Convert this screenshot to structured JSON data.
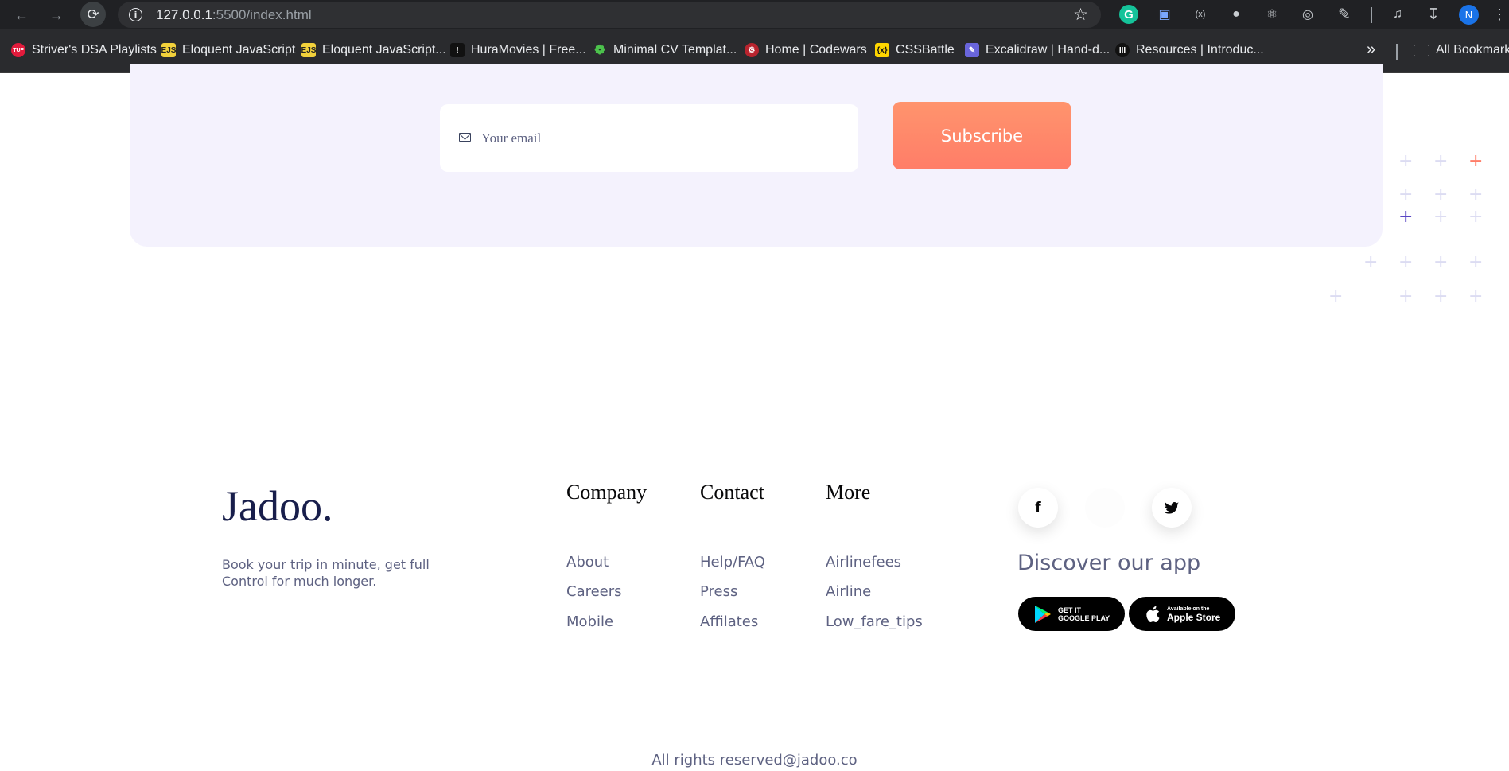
{
  "browser": {
    "url_host": "127.0.0.1",
    "url_rest": ":5500/index.html",
    "avatar_letter": "N",
    "bookmarks": [
      {
        "label": "Striver's DSA Playlists",
        "icon": "TUF"
      },
      {
        "label": "Eloquent JavaScript",
        "icon": "EJS"
      },
      {
        "label": "Eloquent JavaScript...",
        "icon": "EJS"
      },
      {
        "label": "HuraMovies | Free...",
        "icon": "!"
      },
      {
        "label": "Minimal CV Templat...",
        "icon": "❁"
      },
      {
        "label": "Home | Codewars",
        "icon": "⚙"
      },
      {
        "label": "CSSBattle",
        "icon": "{x}"
      },
      {
        "label": "Excalidraw | Hand-d...",
        "icon": "✎"
      },
      {
        "label": "Resources | Introduc...",
        "icon": "III"
      }
    ],
    "all_bookmarks": "All Bookmarks"
  },
  "newsletter": {
    "email_placeholder": "Your email",
    "subscribe_label": "Subscribe"
  },
  "footer": {
    "logo": "Jadoo.",
    "tagline": "Book your trip in minute, get full Control for much longer.",
    "columns": [
      {
        "title": "Company",
        "links": [
          "About",
          "Careers",
          "Mobile"
        ]
      },
      {
        "title": "Contact",
        "links": [
          "Help/FAQ",
          "Press",
          "Affilates"
        ]
      },
      {
        "title": "More",
        "links": [
          "Airlinefees",
          "Airline",
          "Low_fare_tips"
        ]
      }
    ],
    "social": {
      "facebook": "f"
    },
    "discover": "Discover our app",
    "google_play": {
      "small": "GET IT",
      "big": "GOOGLE PLAY"
    },
    "app_store": {
      "small": "Available on the",
      "big": "Apple Store"
    },
    "copyright": "All rights reserved@jadoo.co"
  },
  "colors": {
    "accent_orange": "#ff7d68",
    "accent_purple": "#5a47c4",
    "heading_navy": "#181e4b",
    "body_gray": "#5e6282",
    "card_lavender": "#f4f2fd"
  }
}
